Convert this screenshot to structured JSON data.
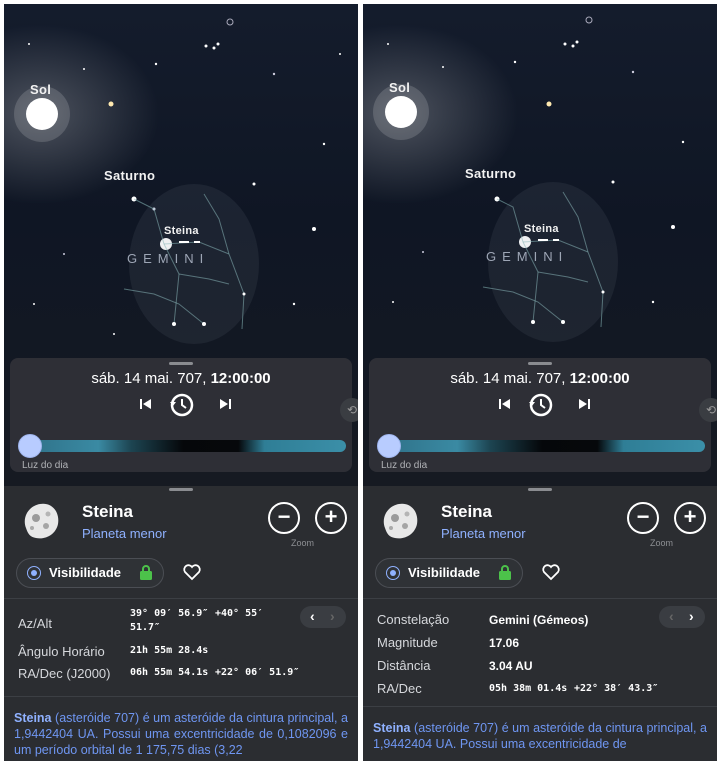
{
  "sky": {
    "labels": {
      "sun": "Sol",
      "saturn": "Saturno",
      "steina": "Steina",
      "constellation": "GEMINI"
    }
  },
  "time_panel": {
    "date": "sáb. 14 mai. 707,",
    "time": "12:00:00",
    "prev_icon": "skip-back-icon",
    "history_icon": "history-clock-icon",
    "next_icon": "skip-forward-icon",
    "daylight_label": "Luz do dia"
  },
  "object": {
    "name": "Steina",
    "type": "Planeta menor",
    "zoom_label": "Zoom",
    "zoom_out": "−",
    "zoom_in": "+",
    "visibility_label": "Visibilidade"
  },
  "left_details": {
    "rows": [
      {
        "label": "Az/Alt",
        "value1": "39° 09′ 56.9″",
        "value2": "+40° 55′",
        "value3": "51.7″"
      },
      {
        "label": "Ângulo Horário",
        "value1": "21h 55m 28.4s"
      },
      {
        "label": "RA/Dec (J2000)",
        "value1": "06h 55m 54.1s",
        "value2": "+22° 06′ 51.9″"
      }
    ],
    "nav_prev": "‹",
    "nav_next": "›"
  },
  "right_details": {
    "rows": [
      {
        "label": "Constelação",
        "value": "Gemini (Gémeos)"
      },
      {
        "label": "Magnitude",
        "value": "17.06"
      },
      {
        "label": "Distância",
        "value": "3.04 AU"
      },
      {
        "label": "RA/Dec",
        "value1": "05h 38m 01.4s",
        "value2": "+22° 38′ 43.3″"
      }
    ],
    "nav_prev": "‹",
    "nav_next": "›"
  },
  "description": {
    "left_name": "Steina",
    "left_text": "(asteróide 707) é um asteróide da cintura principal, a 1,9442404 UA. Possui uma excentricidade de 0,1082096 e um período orbital de 1 175,75 dias (3,22",
    "right_name": "Steina",
    "right_text": "(asteróide 707) é um asteróide da cintura principal, a 1,9442404 UA. Possui uma excentricidade de"
  },
  "colors": {
    "accent": "#8fb1ff",
    "panel": "#2b2d31",
    "sky": "#121a28"
  }
}
